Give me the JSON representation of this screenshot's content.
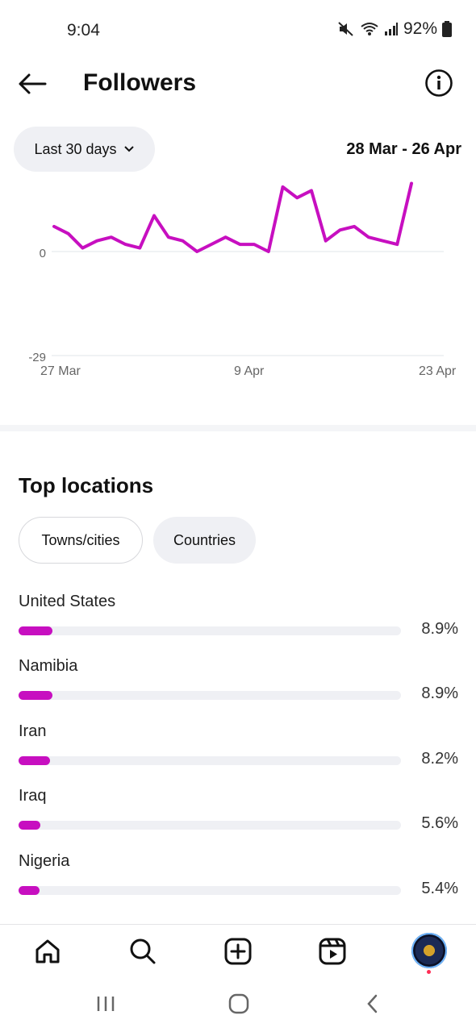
{
  "status": {
    "time": "9:04",
    "battery": "92%"
  },
  "header": {
    "title": "Followers"
  },
  "period": {
    "label": "Last 30 days",
    "date_range": "28 Mar - 26 Apr"
  },
  "chart_data": {
    "type": "line",
    "x_ticks": [
      "27 Mar",
      "9 Apr",
      "23 Apr"
    ],
    "y_ticks": [
      "0",
      "-29"
    ],
    "color": "#c70fc0",
    "grid": true,
    "series": [
      {
        "values": [
          7,
          5,
          1,
          3,
          4,
          2,
          1,
          10,
          4,
          3,
          0,
          2,
          4,
          2,
          2,
          0,
          18,
          15,
          17,
          3,
          6,
          7,
          4,
          3,
          2,
          19
        ]
      }
    ],
    "ylim_note": "top of plot clipped"
  },
  "locations": {
    "title": "Top locations",
    "tabs": [
      {
        "label": "Towns/cities"
      },
      {
        "label": "Countries"
      }
    ],
    "items": [
      {
        "name": "United States",
        "pct_label": "8.9%",
        "value": 8.9
      },
      {
        "name": "Namibia",
        "pct_label": "8.9%",
        "value": 8.9
      },
      {
        "name": "Iran",
        "pct_label": "8.2%",
        "value": 8.2
      },
      {
        "name": "Iraq",
        "pct_label": "5.6%",
        "value": 5.6
      },
      {
        "name": "Nigeria",
        "pct_label": "5.4%",
        "value": 5.4
      }
    ],
    "bar_color": "#c70fc0"
  },
  "nav": {
    "items": [
      "home-icon",
      "search-icon",
      "create-icon",
      "reels-icon",
      "profile-avatar"
    ]
  }
}
